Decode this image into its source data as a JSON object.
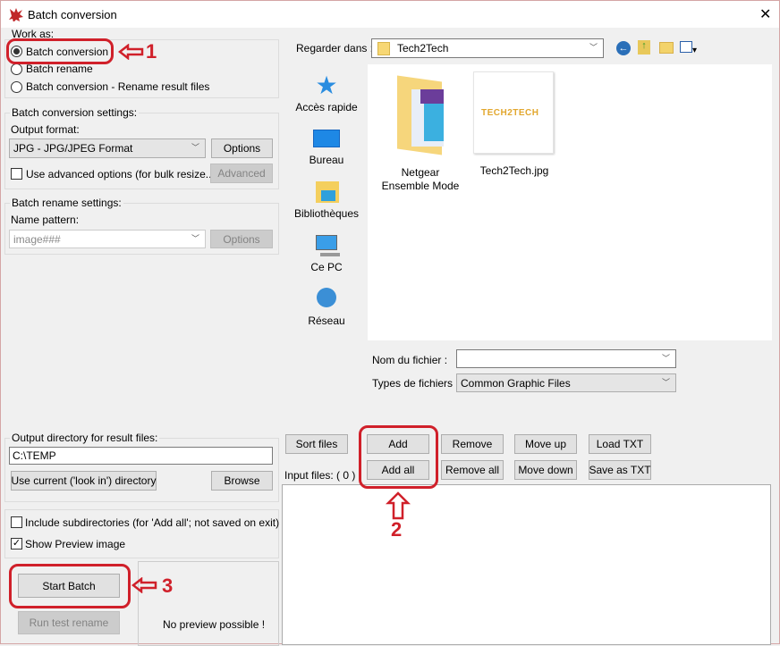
{
  "window": {
    "title": "Batch conversion",
    "close": "✕"
  },
  "work_as": {
    "legend": "Work as:",
    "options": [
      {
        "label": "Batch conversion",
        "selected": true
      },
      {
        "label": "Batch rename",
        "selected": false
      },
      {
        "label": "Batch conversion - Rename result files",
        "selected": false
      }
    ]
  },
  "conv_settings": {
    "legend": "Batch conversion settings:",
    "output_format_label": "Output format:",
    "output_format": "JPG - JPG/JPEG Format",
    "options_btn": "Options",
    "advanced_check": "Use advanced options (for bulk resize...)",
    "advanced_checked": false,
    "advanced_btn": "Advanced"
  },
  "rename_settings": {
    "legend": "Batch rename settings:",
    "pattern_label": "Name pattern:",
    "pattern": "image###",
    "options_btn": "Options"
  },
  "output_dir": {
    "legend": "Output directory for result files:",
    "value": "C:\\TEMP",
    "use_current_btn": "Use current ('look in') directory",
    "browse_btn": "Browse"
  },
  "misc": {
    "include_subdirs": "Include subdirectories (for 'Add all'; not saved on exit)",
    "include_subdirs_checked": false,
    "show_preview": "Show Preview image",
    "show_preview_checked": true
  },
  "actions": {
    "start_batch": "Start Batch",
    "run_test_rename": "Run test rename"
  },
  "preview": {
    "text": "No preview possible !"
  },
  "browser": {
    "look_in_label": "Regarder dans :",
    "look_in": "Tech2Tech",
    "places": [
      "Accès rapide",
      "Bureau",
      "Bibliothèques",
      "Ce PC",
      "Réseau"
    ],
    "files": [
      {
        "name": "Netgear Ensemble Mode",
        "type": "folder"
      },
      {
        "name": "Tech2Tech.jpg",
        "type": "image",
        "logo": "TECH2TECH"
      }
    ],
    "filename_label": "Nom du fichier :",
    "filename": "",
    "filetype_label": "Types de fichiers :",
    "filetype": "Common Graphic Files"
  },
  "file_buttons": {
    "sort": "Sort files",
    "add": "Add",
    "add_all": "Add all",
    "remove": "Remove",
    "remove_all": "Remove all",
    "move_up": "Move up",
    "move_down": "Move down",
    "load_txt": "Load TXT",
    "save_txt": "Save as TXT"
  },
  "input_files": {
    "label": "Input files: ( 0 )",
    "items": []
  },
  "annotations": {
    "one": "1",
    "two": "2",
    "three": "3",
    "color": "#d0202a"
  }
}
